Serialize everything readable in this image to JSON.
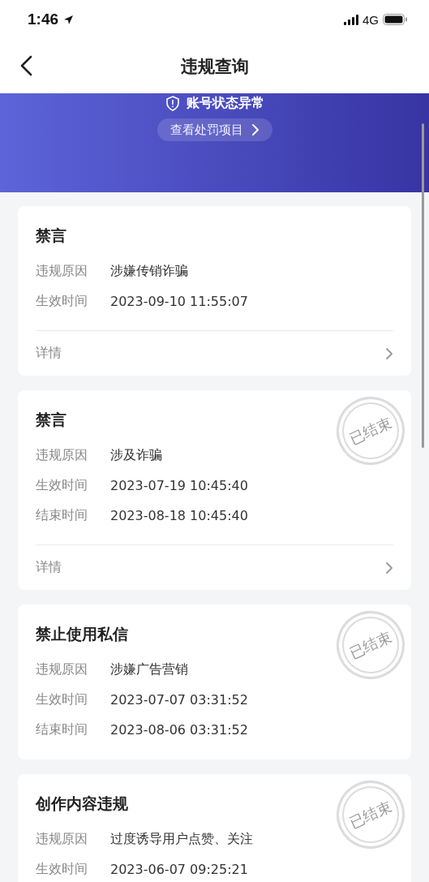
{
  "status_bar": {
    "time": "1:46",
    "network": "4G"
  },
  "nav": {
    "title": "违规查询"
  },
  "banner": {
    "status": "账号状态异常",
    "button": "查看处罚项目"
  },
  "records": [
    {
      "title": "禁言",
      "fields": [
        {
          "label": "违规原因",
          "value": "涉嫌传销诈骗"
        },
        {
          "label": "生效时间",
          "value": "2023-09-10 11:55:07"
        }
      ],
      "details": "详情"
    },
    {
      "title": "禁言",
      "stamp": "已结束",
      "fields": [
        {
          "label": "违规原因",
          "value": "涉及诈骗"
        },
        {
          "label": "生效时间",
          "value": "2023-07-19 10:45:40"
        },
        {
          "label": "结束时间",
          "value": "2023-08-18 10:45:40"
        }
      ],
      "details": "详情"
    },
    {
      "title": "禁止使用私信",
      "stamp": "已结束",
      "fields": [
        {
          "label": "违规原因",
          "value": "涉嫌广告营销"
        },
        {
          "label": "生效时间",
          "value": "2023-07-07 03:31:52"
        },
        {
          "label": "结束时间",
          "value": "2023-08-06 03:31:52"
        }
      ]
    },
    {
      "title": "创作内容违规",
      "stamp": "已结束",
      "fields": [
        {
          "label": "违规原因",
          "value": "过度诱导用户点赞、关注"
        },
        {
          "label": "生效时间",
          "value": "2023-06-07 09:25:21"
        }
      ]
    }
  ]
}
